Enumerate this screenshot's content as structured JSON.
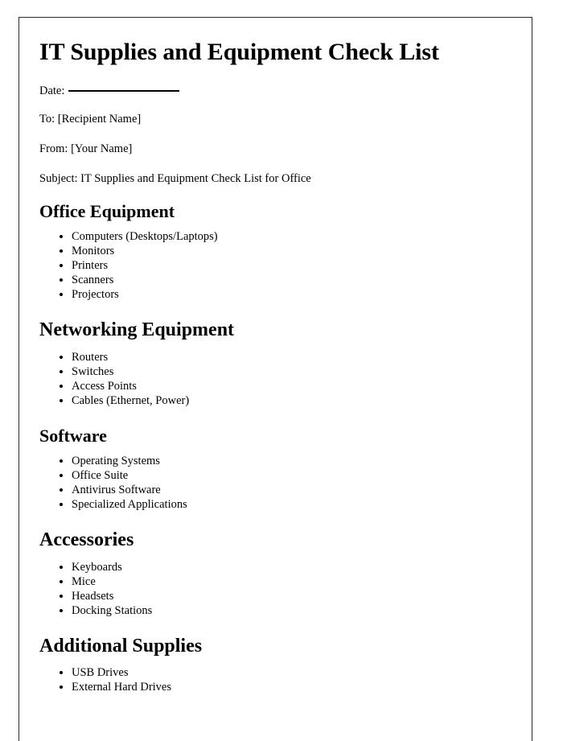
{
  "document": {
    "title": "IT Supplies and Equipment Check List",
    "meta": {
      "date_label": "Date:",
      "to_line": "To: [Recipient Name]",
      "from_line": "From: [Your Name]",
      "subject_line": "Subject: IT Supplies and Equipment Check List for Office"
    },
    "sections": [
      {
        "heading": "Office Equipment",
        "items": [
          "Computers (Desktops/Laptops)",
          "Monitors",
          "Printers",
          "Scanners",
          "Projectors"
        ]
      },
      {
        "heading": "Networking Equipment",
        "items": [
          "Routers",
          "Switches",
          "Access Points",
          "Cables (Ethernet, Power)"
        ]
      },
      {
        "heading": "Software",
        "items": [
          "Operating Systems",
          "Office Suite",
          "Antivirus Software",
          "Specialized Applications"
        ]
      },
      {
        "heading": "Accessories",
        "items": [
          "Keyboards",
          "Mice",
          "Headsets",
          "Docking Stations"
        ]
      },
      {
        "heading": "Additional Supplies",
        "items": [
          "USB Drives",
          "External Hard Drives"
        ]
      }
    ]
  }
}
